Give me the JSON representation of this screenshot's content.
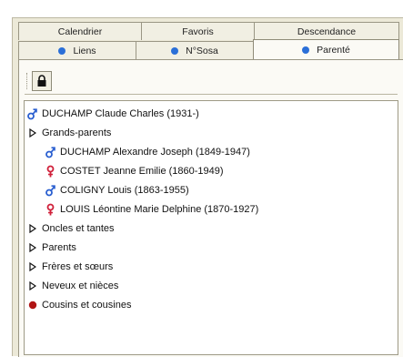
{
  "tabs": {
    "row1": [
      {
        "label": "Calendrier"
      },
      {
        "label": "Favoris"
      },
      {
        "label": "Descendance"
      }
    ],
    "row2": [
      {
        "label": "Liens",
        "icon": "blue-dot-icon"
      },
      {
        "label": "N°Sosa",
        "icon": "blue-dot-icon"
      },
      {
        "label": "Parenté",
        "icon": "blue-dot-icon",
        "active": true
      }
    ]
  },
  "toolbar": {
    "lock_icon": "lock-icon"
  },
  "tree": {
    "root": {
      "label": "DUCHAMP Claude Charles (1931-)",
      "icon": "male-icon"
    },
    "grandparents": {
      "label": "Grands-parents",
      "children": [
        {
          "label": "DUCHAMP Alexandre Joseph (1849-1947)",
          "icon": "male-icon"
        },
        {
          "label": "COSTET Jeanne Emilie (1860-1949)",
          "icon": "female-icon"
        },
        {
          "label": "COLIGNY Louis (1863-1955)",
          "icon": "male-icon"
        },
        {
          "label": "LOUIS Léontine Marie Delphine (1870-1927)",
          "icon": "female-icon"
        }
      ]
    },
    "groups": [
      {
        "label": "Oncles et tantes",
        "icon": "expand-triangle-icon"
      },
      {
        "label": "Parents",
        "icon": "expand-triangle-icon"
      },
      {
        "label": "Frères et sœurs",
        "icon": "expand-triangle-icon"
      },
      {
        "label": "Neveux et nièces",
        "icon": "expand-triangle-icon"
      },
      {
        "label": "Cousins et cousines",
        "icon": "red-dot-icon"
      }
    ]
  },
  "colors": {
    "male": "#2a5fd0",
    "female": "#d0203a",
    "tab_dot": "#2b6fd8",
    "cousins_dot": "#b01515"
  }
}
